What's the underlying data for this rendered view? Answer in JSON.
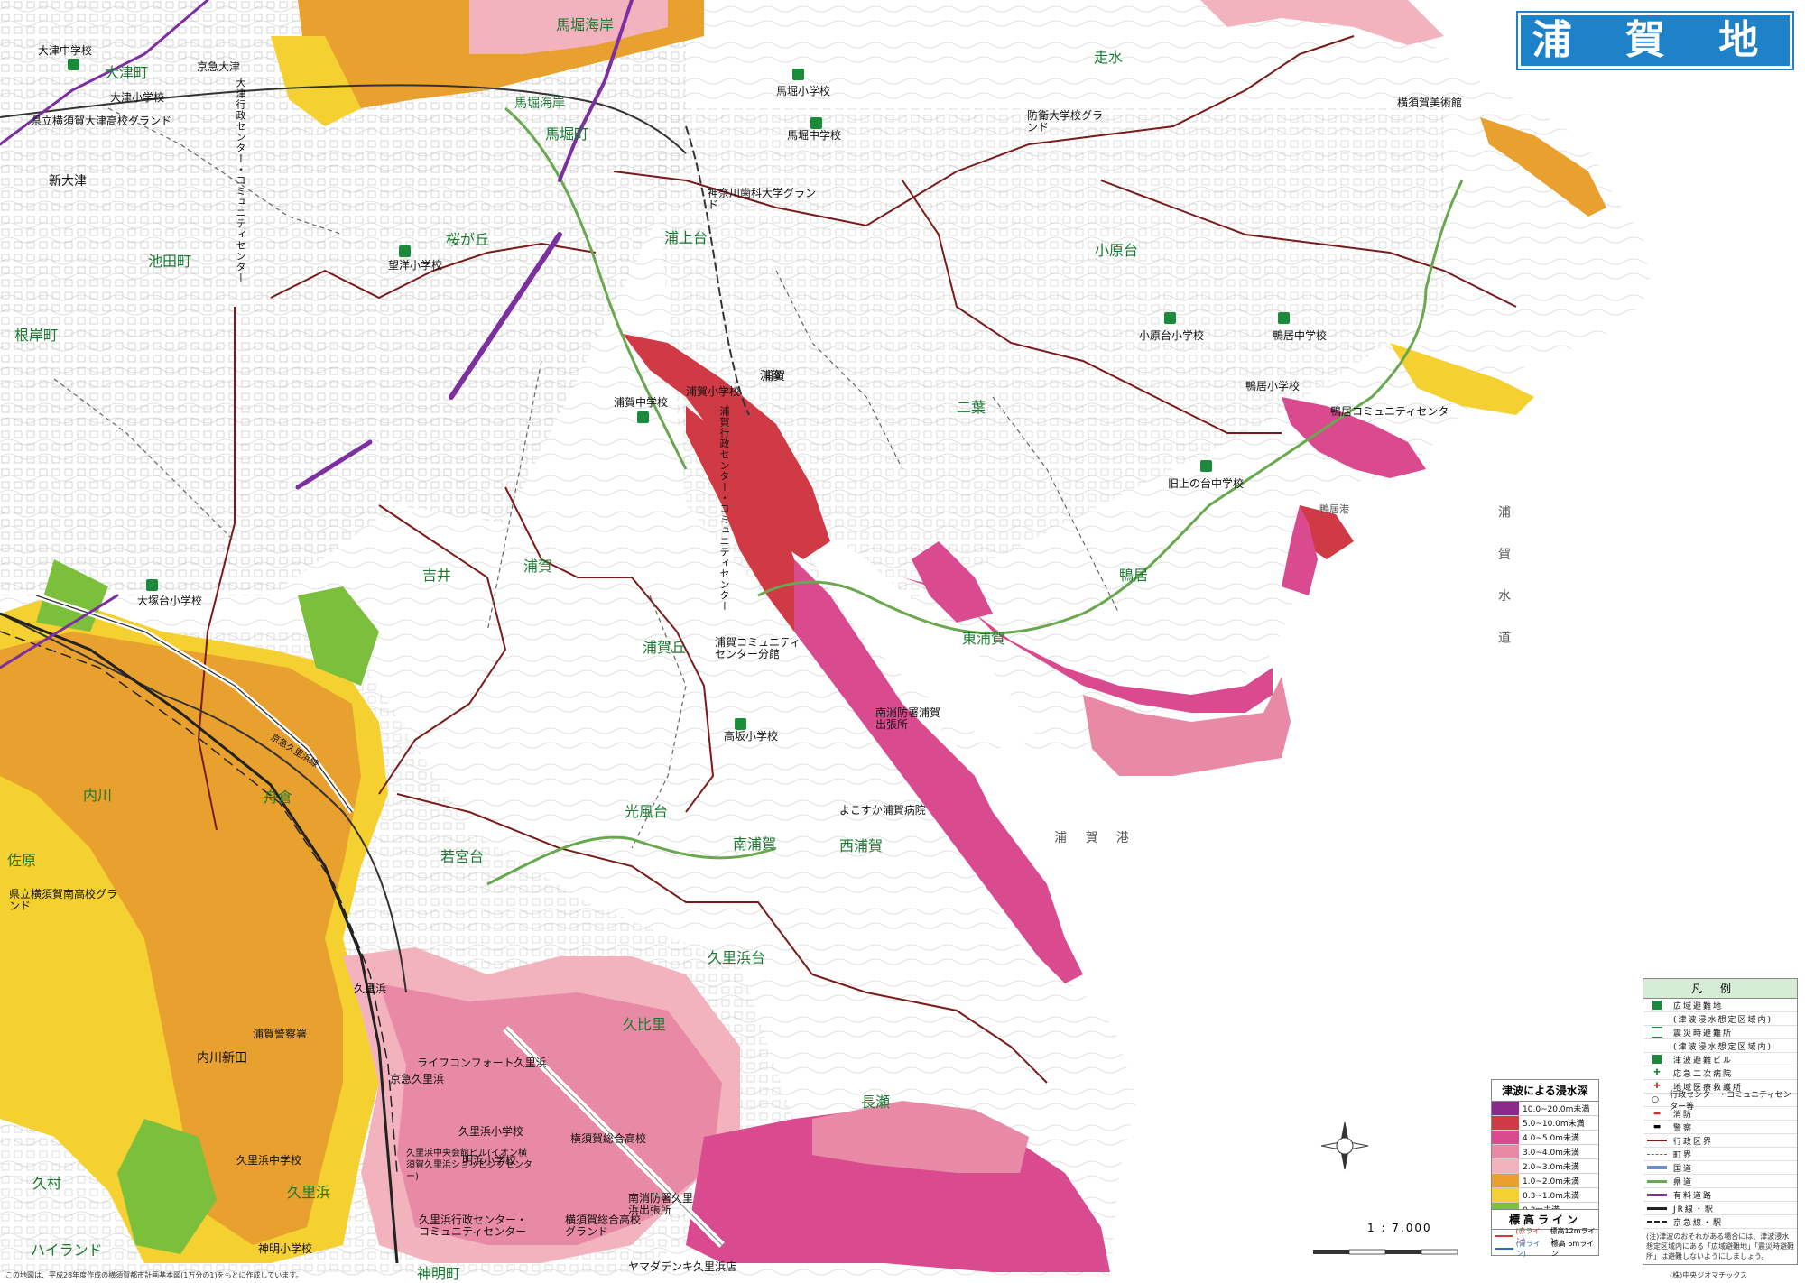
{
  "title": "浦 賀 地 区",
  "place_labels": [
    {
      "text": "馬堀海岸",
      "x": 0
    },
    {
      "text": "走水"
    },
    {
      "text": "馬堀海岸"
    },
    {
      "text": "馬堀町"
    },
    {
      "text": "大津町"
    },
    {
      "text": "新大津"
    },
    {
      "text": "池田町"
    },
    {
      "text": "桜が丘"
    },
    {
      "text": "浦上台"
    },
    {
      "text": "小原台"
    },
    {
      "text": "根岸町"
    },
    {
      "text": "浦賀"
    },
    {
      "text": "二葉"
    },
    {
      "text": "吉井"
    },
    {
      "text": "浦賀"
    },
    {
      "text": "鴨居"
    },
    {
      "text": "浦賀丘"
    },
    {
      "text": "東浦賀"
    },
    {
      "text": "内川"
    },
    {
      "text": "舟倉"
    },
    {
      "text": "佐原"
    },
    {
      "text": "光風台"
    },
    {
      "text": "若宮台"
    },
    {
      "text": "南浦賀"
    },
    {
      "text": "西浦賀"
    },
    {
      "text": "久里浜台"
    },
    {
      "text": "久比里"
    },
    {
      "text": "長瀬"
    },
    {
      "text": "久村"
    },
    {
      "text": "久里浜"
    },
    {
      "text": "ハイランド"
    },
    {
      "text": "内川新田"
    },
    {
      "text": "神明町"
    }
  ],
  "facility_labels": {
    "otsu_jhs": "大津中学校",
    "otsu_es": "大津小学校",
    "otsu_hs": "県立横須賀大津高校グランド",
    "keikyu_otsu": "京急大津",
    "otsu_center": "大津行政センター・コミュニティセンター",
    "maborikaigan_es": "馬堀小学校",
    "mabori_jhs": "馬堀中学校",
    "bouei_ground": "防衛大学校グランド",
    "kanagawa_dental": "神奈川歯科大学グランド",
    "museum": "横須賀美術館",
    "boyo_es": "望洋小学校",
    "obaradai_es": "小原台小学校",
    "kamoi_jhs": "鴨居中学校",
    "kamoi_es": "鴨居小学校",
    "kamoi_center": "鴨居コミュニティセンター",
    "uenodai_es": "旧上の台中学校",
    "uraga_jhs": "浦賀中学校",
    "uraga_es": "浦賀小学校",
    "uraga_station": "浦賀",
    "uraga_center": "浦賀行政センター・コミュニティセンター",
    "otsukadai_es": "大塚台小学校",
    "uraga_branch": "浦賀コミュニティセンター分館",
    "takasaka_es": "高坂小学校",
    "fire_south": "南消防署浦賀出張所",
    "hospital": "よこすか浦賀病院",
    "kurihama_hs": "県立横須賀南高校グランド",
    "keikyu_kurihama": "京急久里浜",
    "life_comfort": "ライフコンフォート久里浜",
    "kurihama_es": "久里浜小学校",
    "yokosuka_sogo": "横須賀総合高校",
    "akehama_es": "明浜小学校",
    "chuo_bldg": "久里浜中央会館ビル(イオン横須賀久里浜ショッピングセンター)",
    "kurihama_jhs": "久里浜中学校",
    "kurihama_center": "久里浜行政センター・コミュニティセンター",
    "yokosuka_sogo_gr": "横須賀総合高校グランド",
    "yamada": "ヤマダデンキ久里浜店",
    "fire_kurihama": "南消防署久里浜出張所",
    "uraga_police": "浦賀警察署",
    "shinmei_es": "神明小学校",
    "jr_kurihama": "久里浜",
    "keikyu_line": "京急久里浜線"
  },
  "sea_labels": {
    "bay": "浦 賀 港",
    "channel": "浦 賀 水 道",
    "kamoi_port": "鴨居港"
  },
  "depth_legend": {
    "title": "津波による浸水深",
    "rows": [
      {
        "label": "10.0~20.0m未満",
        "color": "#8c2a8c"
      },
      {
        "label": "5.0~10.0m未満",
        "color": "#cf3a45"
      },
      {
        "label": "4.0~5.0m未満",
        "color": "#d94b8e"
      },
      {
        "label": "3.0~4.0m未満",
        "color": "#e88aa6"
      },
      {
        "label": "2.0~3.0m未満",
        "color": "#f2b3bf"
      },
      {
        "label": "1.0~2.0m未満",
        "color": "#e8a02e"
      },
      {
        "label": "0.3~1.0m未満",
        "color": "#f4d130"
      },
      {
        "label": "0.3m未満",
        "color": "#7bbf3c"
      }
    ]
  },
  "contour_legend": {
    "title": "標高ライン",
    "rows": [
      {
        "label": "標高12mライン",
        "tag": "(赤ライン)",
        "color": "#d23a3a"
      },
      {
        "label": "標高 6mライン",
        "tag": "(青ライン)",
        "color": "#2a6fc0"
      }
    ]
  },
  "legend": {
    "title": "凡例",
    "rows": [
      "広域避難地",
      "(津波浸水想定区域内)",
      "震災時避難所",
      "(津波浸水想定区域内)",
      "津波避難ビル",
      "応急二次病院",
      "地域医療救護所",
      "行政センター・コミュニティセンター等",
      "消防",
      "警察",
      "行政区界",
      "町界",
      "国道",
      "県道",
      "有料道路",
      "JR線・駅",
      "京急線・駅"
    ],
    "note": "(注)津波のおそれがある場合には、津波浸水想定区域内にある「広域避難地」「震災時避難所」は避難しないようにしましょう。"
  },
  "scale": "1 : 7,000",
  "footer_left": "この地図は、平成28年度作成の横須賀都市計画基本図(1万分の1)をもとに作成しています。",
  "footer_right": "(株)中央ジオマチックス",
  "colors": {
    "sea": "#ffffff",
    "land": "#ffffff",
    "admin_line": "#7a1a1a",
    "road_green": "#6aa84f",
    "toll_road": "#7b2fa0",
    "title_bg": "#1e82c8"
  }
}
